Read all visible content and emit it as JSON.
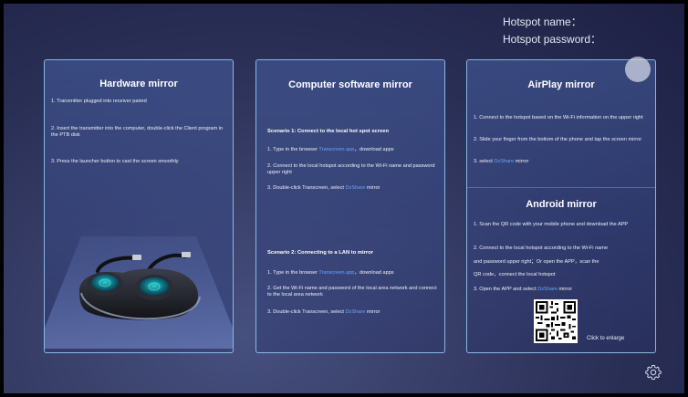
{
  "hotspot": {
    "name_label": "Hotspot name：",
    "password_label": "Hotspot password："
  },
  "hardware": {
    "title": "Hardware mirror",
    "steps": [
      "1. Transmitter plugged into receiver paired",
      "2. Insert the transmitter into the computer, double-click the Client program in the PTB disk",
      "3. Press the launcher button to cast the screen smoothly"
    ]
  },
  "computer": {
    "title": "Computer software mirror",
    "scenario1": {
      "title": "Scenario 1: Connect to the local hot spot screen",
      "step1_pre": "1. Type in the browser ",
      "step1_link": "Transcreen.app",
      "step1_post": "，download apps",
      "step2": "2. Connect to the local hotspot according to the Wi-Fi name and password upper right",
      "step3_pre": "3. Double-click Transcreen, select ",
      "step3_link": "DzShare",
      "step3_post": " mirror"
    },
    "scenario2": {
      "title": "Scenario 2: Connecting to a LAN to mirror",
      "step1_pre": "1. Type in the browser ",
      "step1_link": "Transcreen.app",
      "step1_post": "，download apps",
      "step2": "2. Get the Wi-Fi name and password of the local area network and connect to the local area network",
      "step3_pre": "3. Double-click Transcreen, select ",
      "step3_link": "DzShare",
      "step3_post": " mirror"
    }
  },
  "airplay": {
    "title": "AirPlay mirror",
    "step1": "1. Connect to the hotspot based on the Wi-Fi information on the upper right",
    "step2": "2. Slide your finger from the bottom of the phone and tap the screen mirror",
    "step3_pre": "3. select ",
    "step3_link": "DzShare",
    "step3_post": " mirror"
  },
  "android": {
    "title": "Android mirror",
    "step1": "1. Scan the QR code with your mobile phone and download the APP",
    "step2a": "2. Connect to the local hotspot according to the Wi-Fi name",
    "step2b": "and password upper right；Or open the APP，scan the",
    "step2c": "QR code，connect the local hotspot",
    "step3_pre": "3. Open the APP and select ",
    "step3_link": "DzShare",
    "step3_post": " mirror",
    "enlarge": "Click to enlarge"
  },
  "colors": {
    "accent_link": "#6aa4ff",
    "card_border": "#96cdf5"
  },
  "icons": {
    "settings": "gear-icon",
    "toggle": "circle-toggle"
  }
}
